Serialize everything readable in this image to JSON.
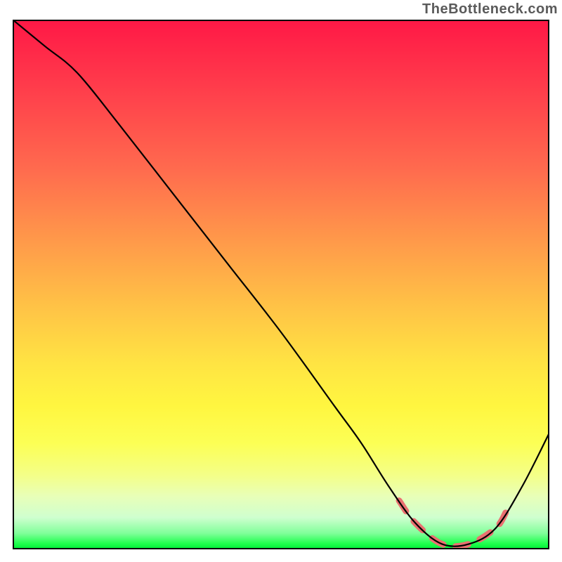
{
  "attribution": "TheBottleneck.com",
  "chart_data": {
    "type": "line",
    "title": "",
    "xlabel": "",
    "ylabel": "",
    "xlim": [
      0,
      100
    ],
    "ylim": [
      0,
      100
    ],
    "series": [
      {
        "name": "bottleneck-curve",
        "x": [
          0,
          6,
          12,
          20,
          30,
          40,
          50,
          60,
          65,
          70,
          75,
          80,
          85,
          90,
          95,
          100
        ],
        "y": [
          100,
          95,
          90,
          80,
          67,
          54,
          41,
          27,
          20,
          12,
          5,
          1,
          1,
          4,
          12,
          22
        ]
      }
    ],
    "optimal_range": {
      "x_start": 72,
      "x_end": 92
    },
    "colors": {
      "gradient_top": "#ff1846",
      "gradient_bottom": "#00e838",
      "curve": "#000000",
      "optimal_dash": "#e97070"
    }
  }
}
